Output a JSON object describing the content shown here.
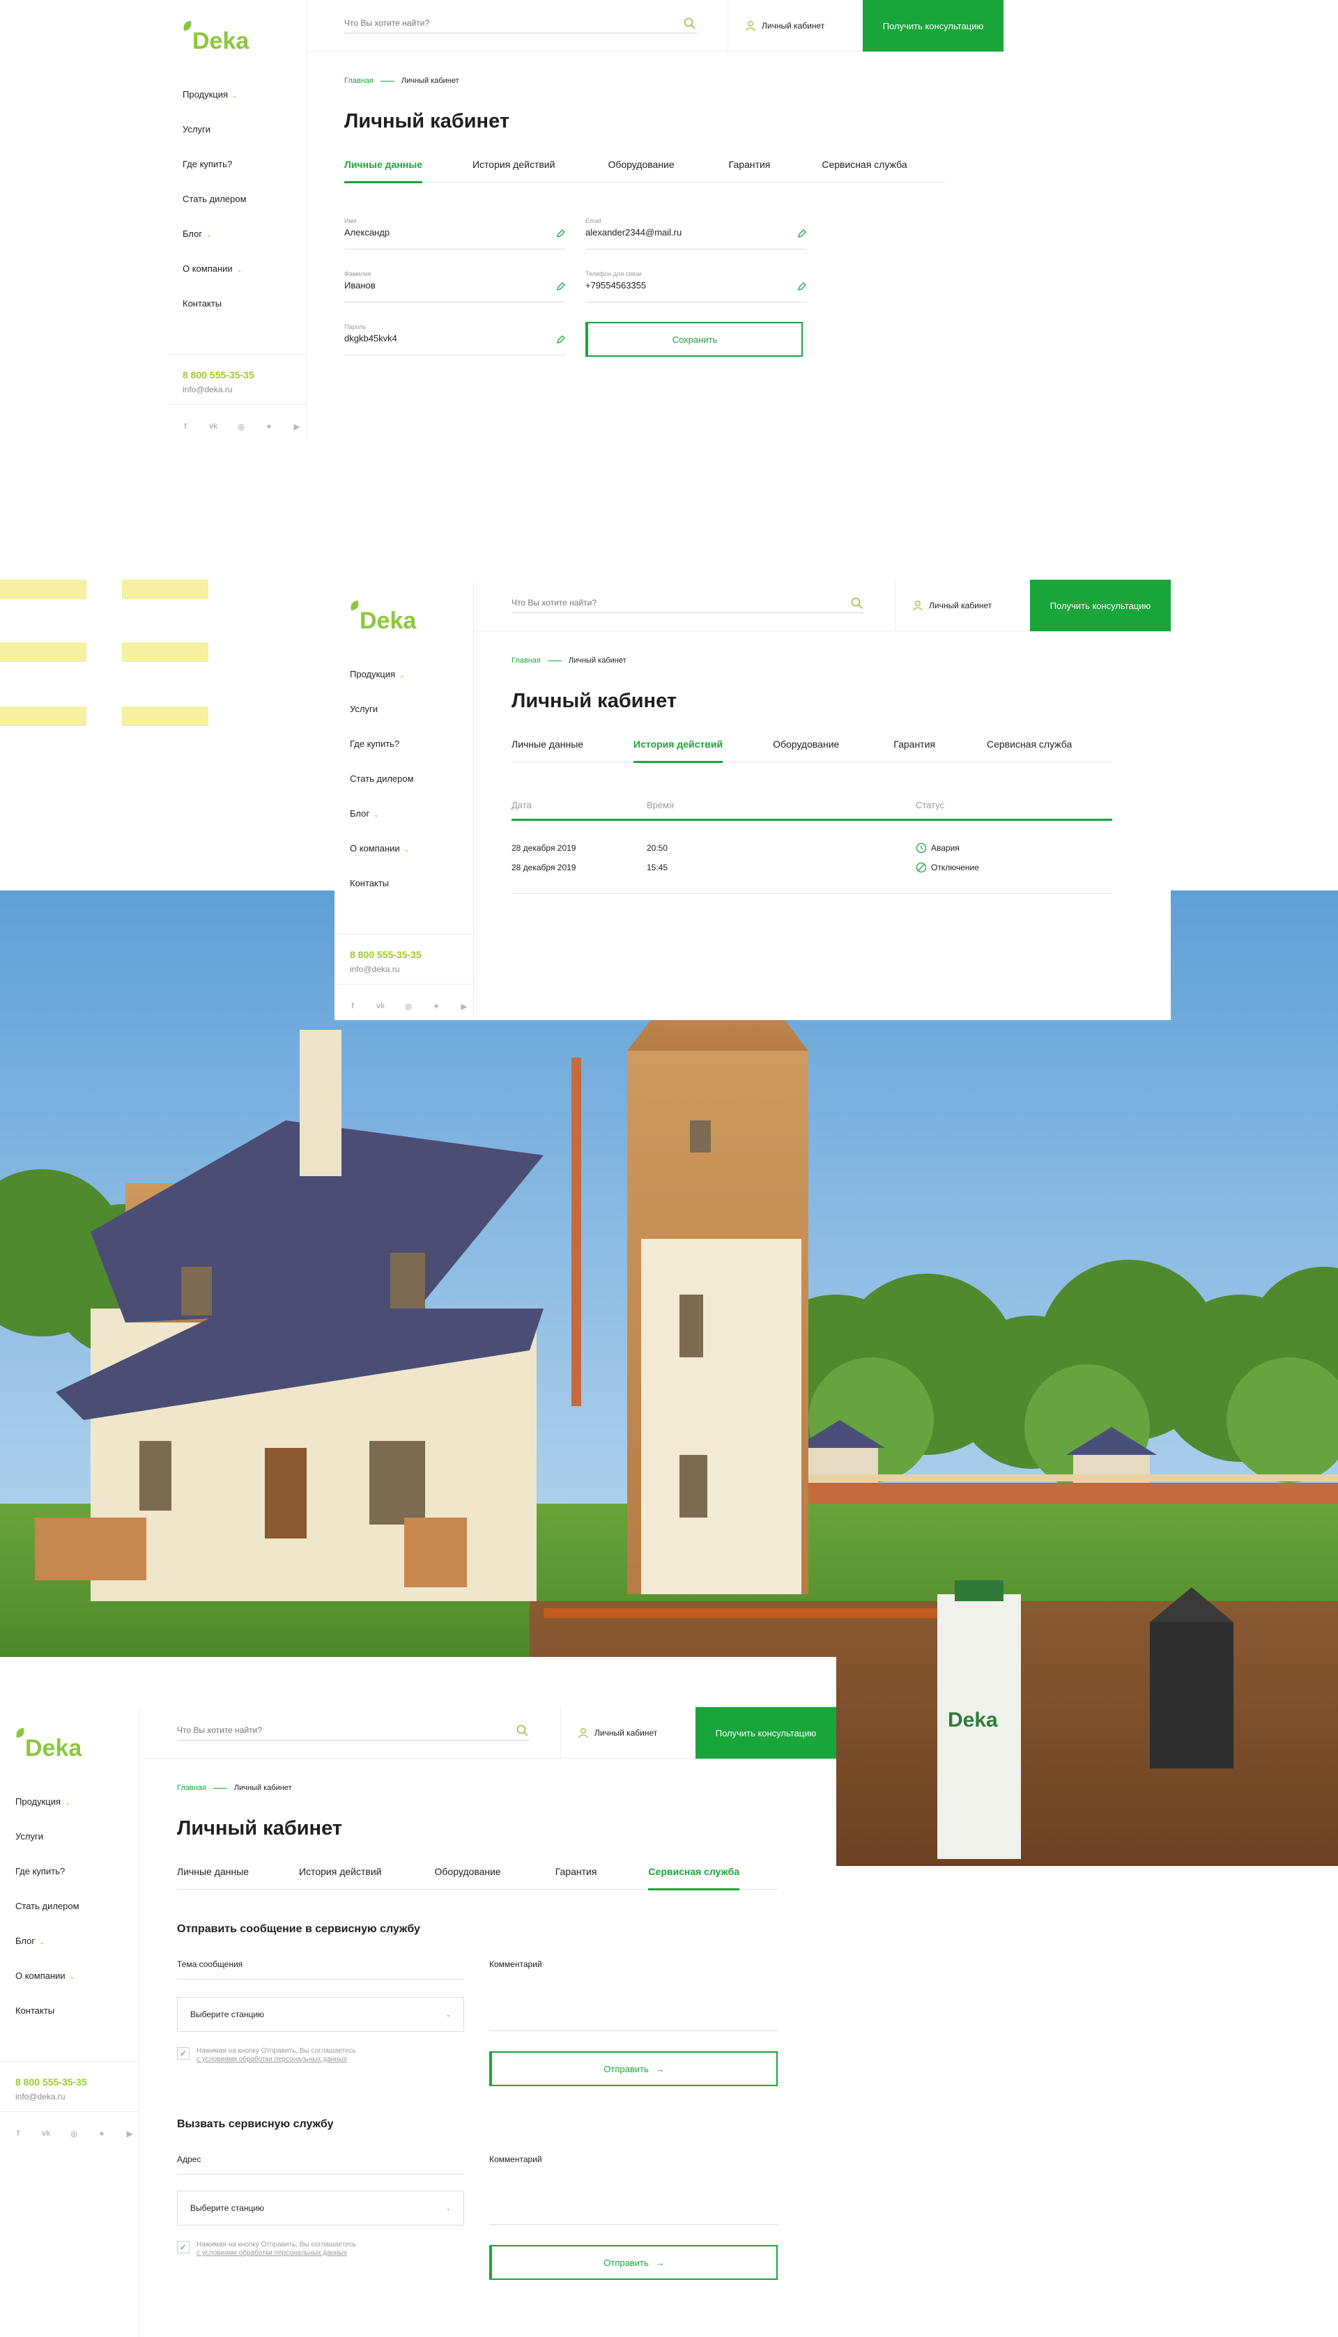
{
  "brand": {
    "name": "Deka",
    "accent": "#19a53a",
    "lime": "#8cc63e",
    "phone_color": "#9ccb2c"
  },
  "sidebar": {
    "items": [
      {
        "label": "Продукция",
        "dropdown": true
      },
      {
        "label": "Услуги",
        "dropdown": false
      },
      {
        "label": "Где купить?",
        "dropdown": false
      },
      {
        "label": "Стать дилером",
        "dropdown": false
      },
      {
        "label": "Блог",
        "dropdown": true
      },
      {
        "label": "О компании",
        "dropdown": true
      },
      {
        "label": "Контакты",
        "dropdown": false
      }
    ],
    "phone": "8 800 555-35-35",
    "email": "info@deka.ru",
    "socials": [
      "f",
      "vk",
      "inst",
      "tw",
      "yt"
    ]
  },
  "topbar": {
    "search_placeholder": "Что Вы хотите найти?",
    "cabinet_label": "Личный кабинет",
    "consult_label": "Получить консультацию"
  },
  "breadcrumb": {
    "home": "Главная",
    "current": "Личный кабинет"
  },
  "page_title": "Личный кабинет",
  "tabs": [
    "Личные данные",
    "История действий",
    "Оборудование",
    "Гарантия",
    "Сервисная служба"
  ],
  "personal": {
    "first_name": {
      "label": "Имя",
      "value": "Александр"
    },
    "last_name": {
      "label": "Фамилия",
      "value": "Иванов"
    },
    "password": {
      "label": "Пароль",
      "value": "dkgkb45kvk4"
    },
    "email": {
      "label": "Email",
      "value": "alexander2344@mail.ru"
    },
    "phone": {
      "label": "Телефон для связи",
      "value": "+79554563355"
    },
    "save_label": "Сохранить"
  },
  "history": {
    "columns": [
      "Дата",
      "Время",
      "Статус"
    ],
    "rows": [
      {
        "date": "28 декабря 2019",
        "time": "20:50",
        "status": "Авария",
        "icon": "clock-icon"
      },
      {
        "date": "28 декабря 2019",
        "time": "15:45",
        "status": "Отключение",
        "icon": "disabled-icon"
      }
    ]
  },
  "service": {
    "message_title": "Отправить сообщение в сервисную службу",
    "message_subject_label": "Тема сообщения",
    "comment_label": "Комментарий",
    "select_placeholder": "Выберите станцию",
    "consent_text": "Нажимая на кнопку Отправить, Вы соглашаетесь",
    "consent_link": "с условиями обработки персональных данных",
    "send_label": "Отправить",
    "call_title": "Вызвать сервисную службу",
    "address_label": "Адрес"
  }
}
